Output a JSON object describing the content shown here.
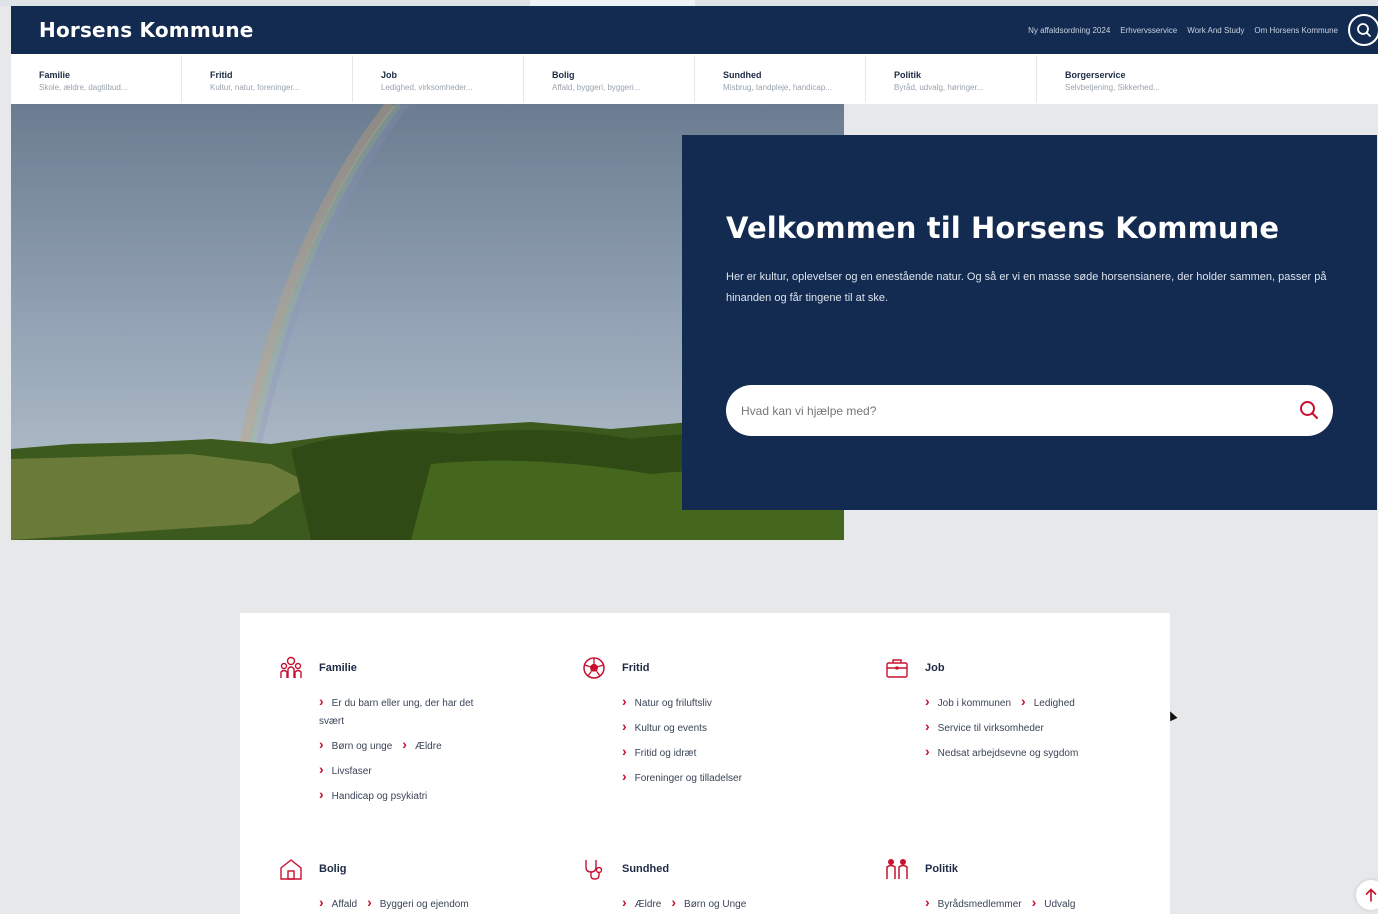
{
  "header": {
    "logo": "Horsens Kommune",
    "links": [
      "Ny affaldsordning 2024",
      "Erhvervsservice",
      "Work And Study",
      "Om Horsens Kommune"
    ]
  },
  "nav": [
    {
      "title": "Familie",
      "sub": "Skole, ældre, dagtilbud..."
    },
    {
      "title": "Fritid",
      "sub": "Kultur, natur, foreninger..."
    },
    {
      "title": "Job",
      "sub": "Ledighed, virksomheder..."
    },
    {
      "title": "Bolig",
      "sub": "Affald, byggeri, byggeri..."
    },
    {
      "title": "Sundhed",
      "sub": "Misbrug, tandpleje, handicap..."
    },
    {
      "title": "Politik",
      "sub": "Byråd, udvalg, høringer..."
    },
    {
      "title": "Borgerservice",
      "sub": "Selvbetjening, Sikkerhed..."
    }
  ],
  "welcome": {
    "title": "Velkommen til Horsens Kommune",
    "text": "Her er kultur, oplevelser og en enestående natur. Og så er vi en masse søde horsensianere, der holder sammen, passer på hinanden og får tingene til at ske.",
    "search_placeholder": "Hvad kan vi hjælpe med?"
  },
  "categories": {
    "familie": {
      "title": "Familie",
      "links": [
        "Er du barn eller ung, der har det svært",
        "Børn og unge",
        "Ældre",
        "Livsfaser",
        "Handicap og psykiatri"
      ]
    },
    "fritid": {
      "title": "Fritid",
      "links": [
        "Natur og friluftsliv",
        "Kultur og events",
        "Fritid og idræt",
        "Foreninger og tilladelser"
      ]
    },
    "job": {
      "title": "Job",
      "links": [
        "Job i kommunen",
        "Ledighed",
        "Service til virksomheder",
        "Nedsat arbejdsevne og sygdom"
      ]
    },
    "bolig": {
      "title": "Bolig",
      "links": [
        "Affald",
        "Byggeri og ejendom"
      ]
    },
    "sundhed": {
      "title": "Sundhed",
      "links": [
        "Ældre",
        "Børn og Unge"
      ]
    },
    "politik": {
      "title": "Politik",
      "links": [
        "Byrådsmedlemmer",
        "Udvalg"
      ]
    }
  },
  "colors": {
    "navy": "#132b50",
    "accent": "#c8102e"
  },
  "icons": [
    "search-icon",
    "family-icon",
    "football-icon",
    "briefcase-icon",
    "house-icon",
    "stethoscope-icon",
    "people-icon",
    "arrow-up-icon"
  ]
}
